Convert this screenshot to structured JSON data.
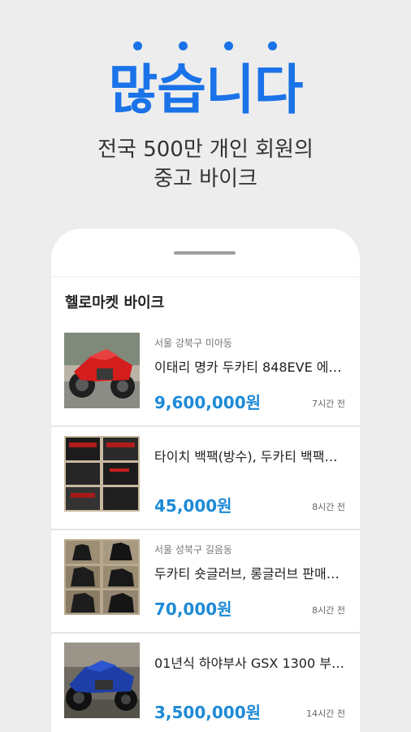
{
  "hero": {
    "headline": "많습니다",
    "subtitle_line1": "전국 500만 개인 회원의",
    "subtitle_line2": "중고 바이크"
  },
  "section": {
    "title": "헬로마켓 바이크"
  },
  "listings": [
    {
      "location": "서울 강북구 미아동",
      "title": "이태리 명카 두카티 848EVE 에…",
      "price": "9,600,000원",
      "time": "7시간 전",
      "image": "red-motorcycle"
    },
    {
      "location": "",
      "title": "타이치 백팩(방수), 두카티 백팩…",
      "price": "45,000원",
      "time": "8시간 전",
      "image": "backpacks"
    },
    {
      "location": "서울 성북구 길음동",
      "title": "두카티 숏글러브, 롱글러브 판매…",
      "price": "70,000원",
      "time": "8시간 전",
      "image": "gloves"
    },
    {
      "location": "",
      "title": "01년식 하야부사 GSX 1300 부…",
      "price": "3,500,000원",
      "time": "14시간 전",
      "image": "blue-motorcycle"
    }
  ],
  "colors": {
    "accent": "#1a73e8",
    "price": "#1e8ad6",
    "background": "#ededed"
  }
}
